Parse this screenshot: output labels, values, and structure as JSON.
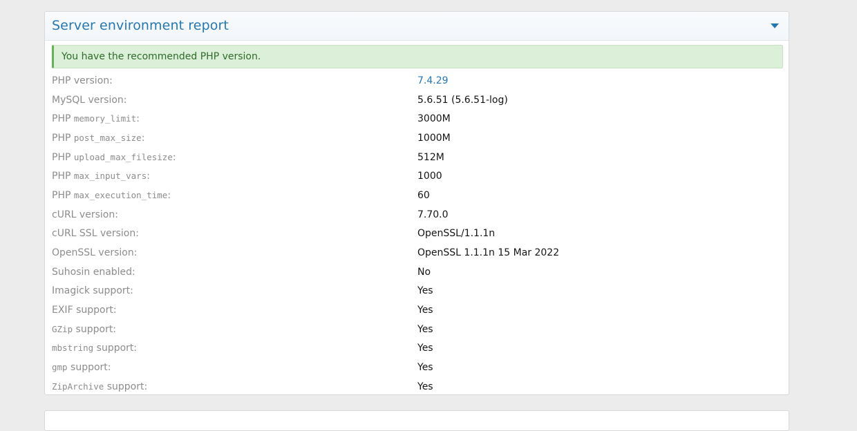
{
  "report": {
    "title": "Server environment report",
    "notice": "You have the recommended PHP version.",
    "rows": [
      {
        "prefix": "PHP version:",
        "code": "",
        "suffix": "",
        "value": "7.4.29"
      },
      {
        "prefix": "MySQL version:",
        "code": "",
        "suffix": "",
        "value": "5.6.51 (5.6.51-log)"
      },
      {
        "prefix": "PHP ",
        "code": "memory_limit",
        "suffix": ":",
        "value": "3000M"
      },
      {
        "prefix": "PHP ",
        "code": "post_max_size",
        "suffix": ":",
        "value": "1000M"
      },
      {
        "prefix": "PHP ",
        "code": "upload_max_filesize",
        "suffix": ":",
        "value": "512M"
      },
      {
        "prefix": "PHP ",
        "code": "max_input_vars",
        "suffix": ":",
        "value": "1000"
      },
      {
        "prefix": "PHP ",
        "code": "max_execution_time",
        "suffix": ":",
        "value": "60"
      },
      {
        "prefix": "cURL version:",
        "code": "",
        "suffix": "",
        "value": "7.70.0"
      },
      {
        "prefix": "cURL SSL version:",
        "code": "",
        "suffix": "",
        "value": "OpenSSL/1.1.1n"
      },
      {
        "prefix": "OpenSSL version:",
        "code": "",
        "suffix": "",
        "value": "OpenSSL 1.1.1n 15 Mar 2022"
      },
      {
        "prefix": "Suhosin enabled:",
        "code": "",
        "suffix": "",
        "value": "No"
      },
      {
        "prefix": "Imagick support:",
        "code": "",
        "suffix": "",
        "value": "Yes"
      },
      {
        "prefix": "EXIF support:",
        "code": "",
        "suffix": "",
        "value": "Yes"
      },
      {
        "prefix": "",
        "code": "GZip",
        "suffix": " support:",
        "value": "Yes"
      },
      {
        "prefix": "",
        "code": "mbstring",
        "suffix": " support:",
        "value": "Yes"
      },
      {
        "prefix": "",
        "code": "gmp",
        "suffix": " support:",
        "value": "Yes"
      },
      {
        "prefix": "",
        "code": "ZipArchive",
        "suffix": " support:",
        "value": "Yes"
      }
    ]
  },
  "colors": {
    "accent": "#2577b1",
    "notice_bg": "#dcefd8",
    "notice_border": "#63b256"
  }
}
